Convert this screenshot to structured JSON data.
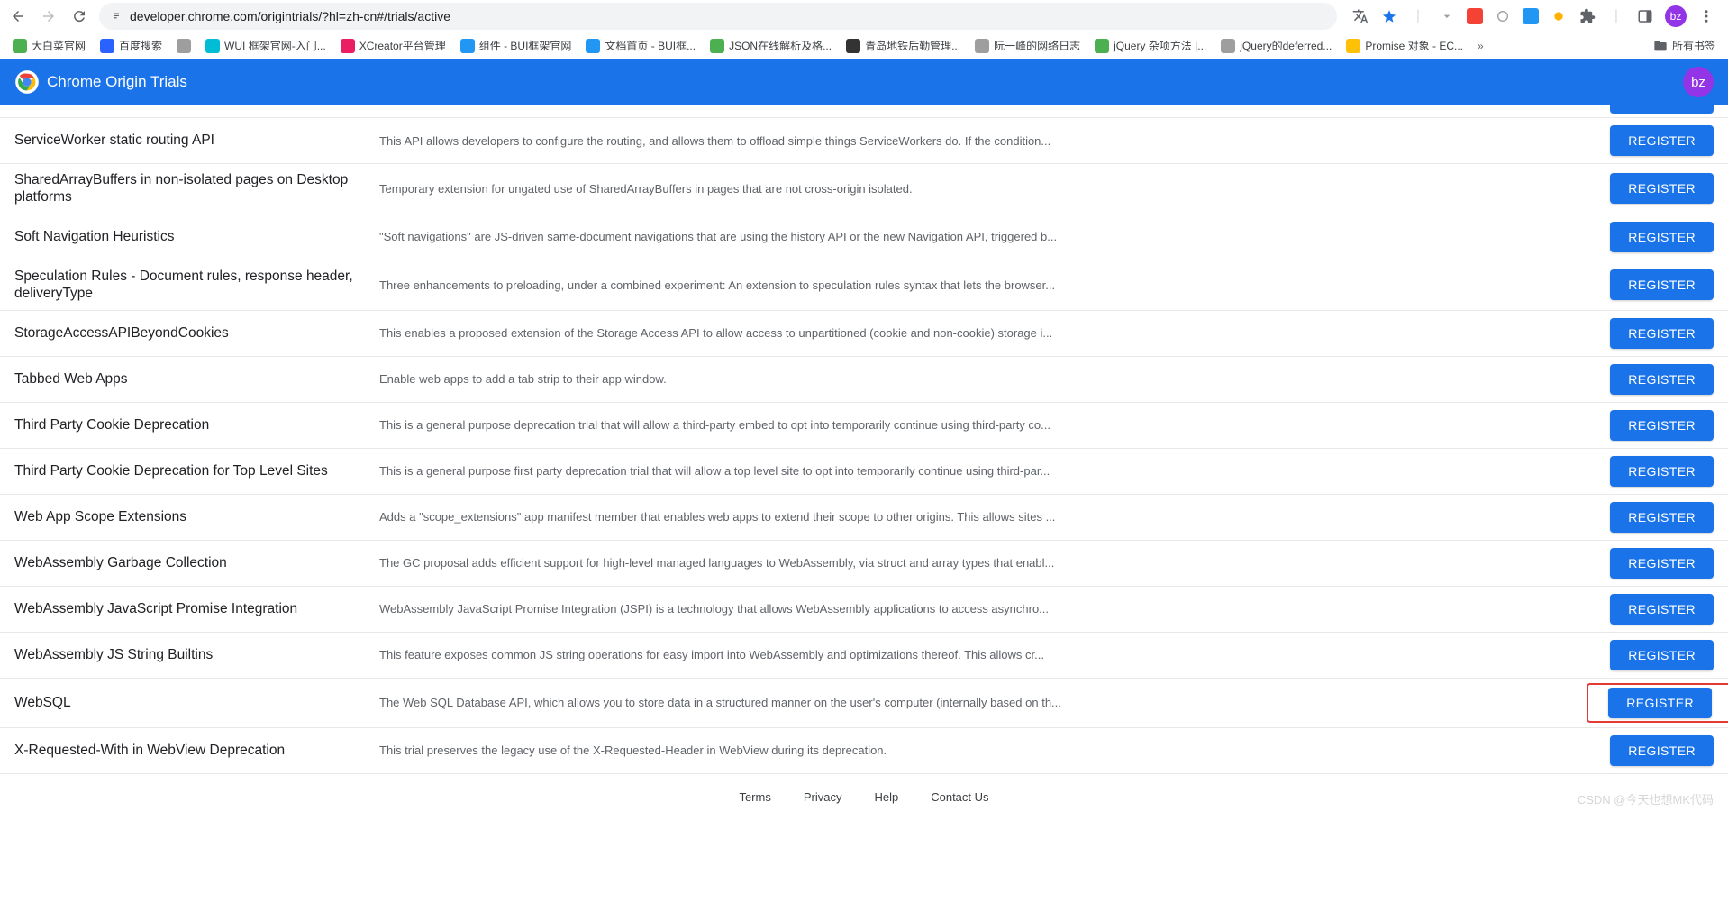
{
  "browser": {
    "url": "developer.chrome.com/origintrials/?hl=zh-cn#/trials/active",
    "avatar": "bz"
  },
  "bookmarks": [
    {
      "label": "大白菜官网",
      "color": "#4caf50"
    },
    {
      "label": "百度搜索",
      "color": "#2962ff"
    },
    {
      "label": "",
      "color": "#9e9e9e"
    },
    {
      "label": "WUI 框架官网-入门...",
      "color": "#00bcd4"
    },
    {
      "label": "XCreator平台管理",
      "color": "#e91e63"
    },
    {
      "label": "组件 - BUI框架官网",
      "color": "#2196f3"
    },
    {
      "label": "文档首页 - BUI框...",
      "color": "#2196f3"
    },
    {
      "label": "JSON在线解析及格...",
      "color": "#4caf50"
    },
    {
      "label": "青岛地铁后勤管理...",
      "color": "#333"
    },
    {
      "label": "阮一峰的网络日志",
      "color": "#9e9e9e"
    },
    {
      "label": "jQuery 杂项方法 |...",
      "color": "#4caf50"
    },
    {
      "label": "jQuery的deferred...",
      "color": "#9e9e9e"
    },
    {
      "label": "Promise 对象 - EC...",
      "color": "#ffc107"
    }
  ],
  "bookmarks_all": "所有书签",
  "header": {
    "title": "Chrome Origin Trials",
    "avatar": "bz"
  },
  "trials": [
    {
      "name": "",
      "desc": "",
      "button": "REGISTER",
      "partial": true
    },
    {
      "name": "ServiceWorker static routing API",
      "desc": "This API allows developers to configure the routing, and allows them to offload simple things ServiceWorkers do. If the condition...",
      "button": "REGISTER"
    },
    {
      "name": "SharedArrayBuffers in non-isolated pages on Desktop platforms",
      "desc": "Temporary extension for ungated use of SharedArrayBuffers in pages that are not cross-origin isolated.",
      "button": "REGISTER"
    },
    {
      "name": "Soft Navigation Heuristics",
      "desc": "\"Soft navigations\" are JS-driven same-document navigations that are using the history API or the new Navigation API, triggered b...",
      "button": "REGISTER"
    },
    {
      "name": "Speculation Rules - Document rules, response header, deliveryType",
      "desc": "Three enhancements to preloading, under a combined experiment: An extension to speculation rules syntax that lets the browser...",
      "button": "REGISTER"
    },
    {
      "name": "StorageAccessAPIBeyondCookies",
      "desc": "This enables a proposed extension of the Storage Access API to allow access to unpartitioned (cookie and non-cookie) storage i...",
      "button": "REGISTER"
    },
    {
      "name": "Tabbed Web Apps",
      "desc": "Enable web apps to add a tab strip to their app window.",
      "button": "REGISTER"
    },
    {
      "name": "Third Party Cookie Deprecation",
      "desc": "This is a general purpose deprecation trial that will allow a third-party embed to opt into temporarily continue using third-party co...",
      "button": "REGISTER"
    },
    {
      "name": "Third Party Cookie Deprecation for Top Level Sites",
      "desc": "This is a general purpose first party deprecation trial that will allow a top level site to opt into temporarily continue using third-par...",
      "button": "REGISTER"
    },
    {
      "name": "Web App Scope Extensions",
      "desc": "Adds a \"scope_extensions\" app manifest member that enables web apps to extend their scope to other origins. This allows sites ...",
      "button": "REGISTER"
    },
    {
      "name": "WebAssembly Garbage Collection",
      "desc": "The GC proposal adds efficient support for high-level managed languages to WebAssembly, via struct and array types that enabl...",
      "button": "REGISTER"
    },
    {
      "name": "WebAssembly JavaScript Promise Integration",
      "desc": "WebAssembly JavaScript Promise Integration (JSPI) is a technology that allows WebAssembly applications to access asynchro...",
      "button": "REGISTER"
    },
    {
      "name": "WebAssembly JS String Builtins",
      "desc": "This feature exposes common JS string operations for easy import into WebAssembly and optimizations thereof. This allows cr...",
      "button": "REGISTER"
    },
    {
      "name": "WebSQL",
      "desc": "The Web SQL Database API, which allows you to store data in a structured manner on the user's computer (internally based on th...",
      "button": "REGISTER",
      "highlight": true
    },
    {
      "name": "X-Requested-With in WebView Deprecation",
      "desc": "This trial preserves the legacy use of the X-Requested-Header in WebView during its deprecation.",
      "button": "REGISTER"
    }
  ],
  "footer": {
    "terms": "Terms",
    "privacy": "Privacy",
    "help": "Help",
    "contact": "Contact Us",
    "watermark": "CSDN @今天也想MK代码"
  }
}
